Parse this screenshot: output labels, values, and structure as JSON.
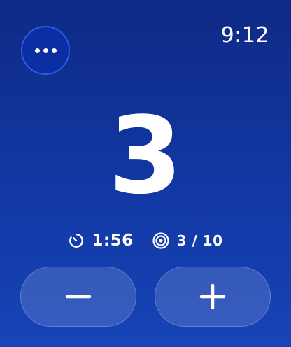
{
  "status": {
    "time": "9:12"
  },
  "menu": {
    "icon": "ellipsis-icon"
  },
  "counter": {
    "value": "3"
  },
  "stats": {
    "timer_icon": "timer-icon",
    "elapsed": "1:56",
    "rounds_icon": "target-icon",
    "rounds": "3 / 10"
  },
  "controls": {
    "decrement_icon": "minus-icon",
    "increment_icon": "plus-icon"
  },
  "colors": {
    "background_top": "#0f2a86",
    "background_bottom": "#1744b8",
    "menu_button": "#0b2fa3",
    "menu_border": "#2b5de6",
    "text": "#ffffff"
  }
}
